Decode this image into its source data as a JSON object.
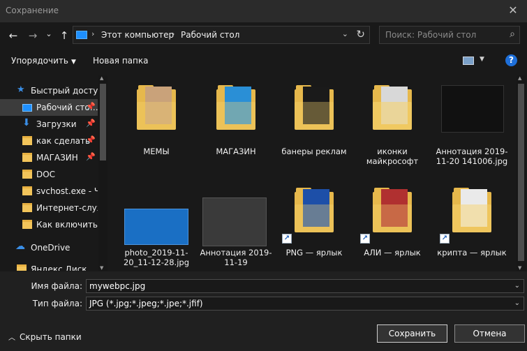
{
  "window": {
    "title": "Сохранение",
    "close_glyph": "✕"
  },
  "nav": {
    "back_glyph": "←",
    "forward_glyph": "→",
    "recent_glyph": "⌄",
    "up_glyph": "↑",
    "breadcrumb": [
      "Этот компьютер",
      "Рабочий стол"
    ],
    "refresh_glyph": "↻",
    "search_placeholder": "Поиск: Рабочий стол",
    "search_glyph": "⌕"
  },
  "toolbar": {
    "organize": "Упорядочить",
    "new_folder": "Новая папка",
    "help": "?"
  },
  "sidebar": {
    "items": [
      {
        "label": "Быстрый доступ",
        "icon": "star-icon",
        "pin": false
      },
      {
        "label": "Рабочий сто…",
        "icon": "desktop-icon",
        "pin": true,
        "selected": true
      },
      {
        "label": "Загрузки",
        "icon": "download-icon",
        "pin": true
      },
      {
        "label": "как сделать",
        "icon": "folder-icon",
        "pin": true
      },
      {
        "label": "МАГАЗИН",
        "icon": "folder-icon",
        "pin": true
      },
      {
        "label": "DOC",
        "icon": "folder-icon",
        "pin": false
      },
      {
        "label": "svchost.exe - Чт",
        "icon": "folder-icon",
        "pin": false
      },
      {
        "label": "Интернет-служ",
        "icon": "folder-icon",
        "pin": false
      },
      {
        "label": "Как включить Ш",
        "icon": "folder-icon",
        "pin": false
      },
      {
        "label": "OneDrive",
        "icon": "cloud-icon",
        "pin": false
      },
      {
        "label": "Яндекс.Диск",
        "icon": "folder-icon",
        "pin": false
      }
    ]
  },
  "files": [
    {
      "label": "МЕМЫ",
      "kind": "folder",
      "accent": "#c9a27a"
    },
    {
      "label": "МАГАЗИН",
      "kind": "folder",
      "accent": "#2a8fd6"
    },
    {
      "label": "банеры реклам",
      "kind": "folder",
      "accent": "#1a1a1a"
    },
    {
      "label": "иконки майкрософт",
      "kind": "folder",
      "accent": "#8a8a8a"
    },
    {
      "label": "Аннотация 2019-11-20 141006.jpg",
      "kind": "image",
      "accent": "#111111"
    },
    {
      "label": "photo_2019-11-20_11-12-28.jpg",
      "kind": "image",
      "accent": "#1a6fc4"
    },
    {
      "label": "Аннотация 2019-11-19",
      "kind": "image",
      "accent": "#3a3a3a"
    },
    {
      "label": "PNG — ярлык",
      "kind": "shortcut",
      "accent": "#1d4fa8"
    },
    {
      "label": "АЛИ — ярлык",
      "kind": "shortcut",
      "accent": "#b03030"
    },
    {
      "label": "крипта — ярлык",
      "kind": "shortcut",
      "accent": "#d8b45a"
    }
  ],
  "form": {
    "filename_label": "Имя файла:",
    "filename_value": "mywebpc.jpg",
    "filetype_label": "Тип файла:",
    "filetype_value": "JPG (*.jpg;*.jpeg;*.jpe;*.jfif)",
    "hide_folders": "Скрыть папки",
    "save": "Сохранить",
    "cancel": "Отмена"
  }
}
